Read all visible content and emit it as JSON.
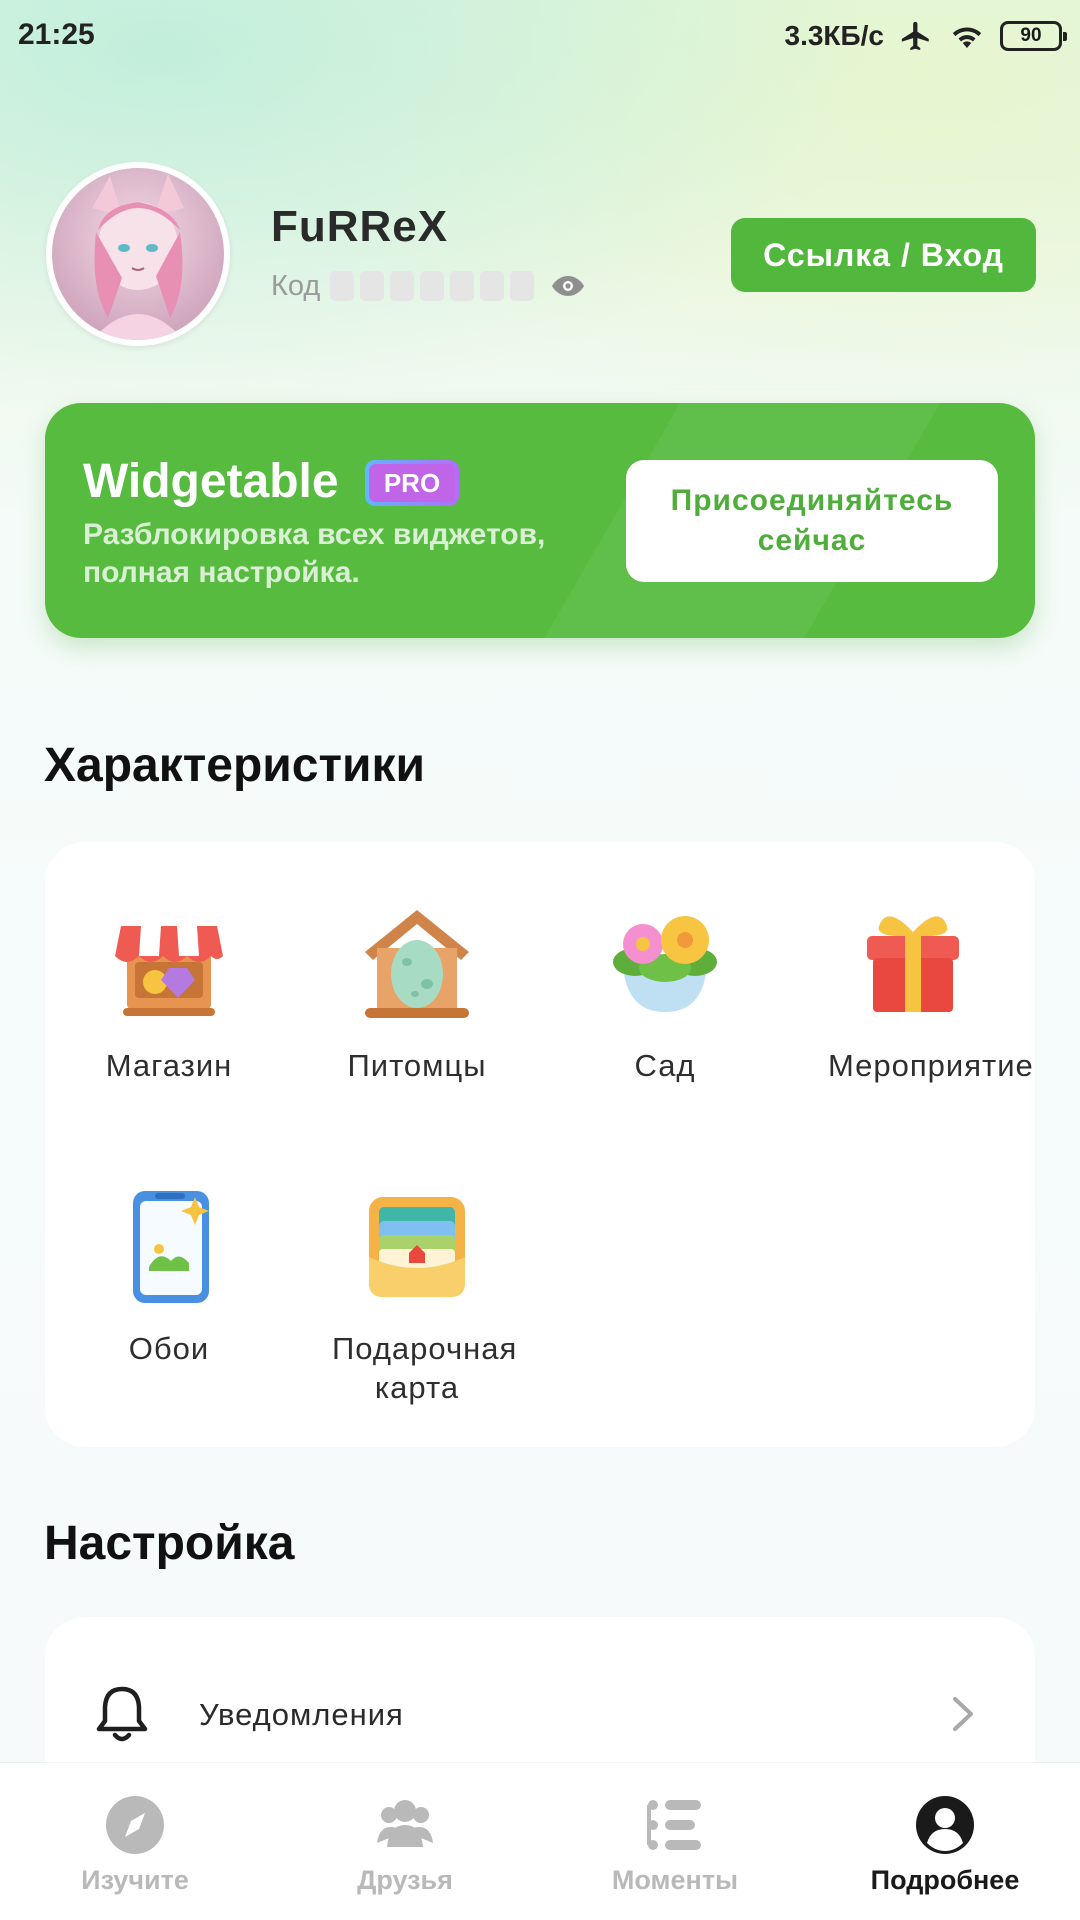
{
  "status_bar": {
    "time": "21:25",
    "speed": "3.3КБ/с",
    "battery": "90",
    "icons": [
      "airplane-icon",
      "wifi-icon",
      "battery-icon"
    ]
  },
  "profile": {
    "username": "FuRReX",
    "code_label": "Код",
    "link_button": "Ссылка / Вход"
  },
  "pro_banner": {
    "title": "Widgetable",
    "badge": "PRO",
    "subtitle": "Разблокировка всех виджетов, полная настройка.",
    "join_button": "Присоединяйтесь сейчас",
    "accent": "#57bb3f"
  },
  "features": {
    "title": "Характеристики",
    "items": [
      {
        "label": "Магазин",
        "icon": "shop-icon"
      },
      {
        "label": "Питомцы",
        "icon": "pet-house-icon"
      },
      {
        "label": "Сад",
        "icon": "garden-icon"
      },
      {
        "label": "Мероприятие",
        "icon": "gift-icon"
      },
      {
        "label": "Обои",
        "icon": "wallpaper-icon"
      },
      {
        "label": "Подарочная карта",
        "icon": "gift-card-icon"
      }
    ]
  },
  "settings": {
    "title": "Настройка",
    "items": [
      {
        "label": "Уведомления",
        "icon": "bell-icon"
      }
    ]
  },
  "bottom_nav": {
    "items": [
      {
        "label": "Изучите",
        "icon": "compass-icon",
        "active": false
      },
      {
        "label": "Друзья",
        "icon": "friends-icon",
        "active": false
      },
      {
        "label": "Моменты",
        "icon": "moments-icon",
        "active": false
      },
      {
        "label": "Подробнее",
        "icon": "profile-icon",
        "active": true
      }
    ]
  }
}
